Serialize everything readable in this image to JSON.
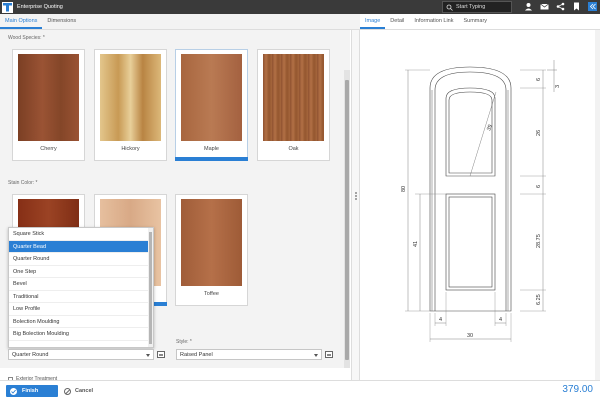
{
  "app": {
    "title": "Enterprise Quoting",
    "search_placeholder": "Start Typing",
    "icons": [
      "user-icon",
      "mail-icon",
      "share-icon",
      "bookmark-icon",
      "collapse-icon"
    ],
    "accent": "#2a7fd4"
  },
  "left_tabs": [
    "Main Options",
    "Dimensions"
  ],
  "wood_species": {
    "label": "Wood Species: *",
    "options": [
      {
        "name": "Cherry",
        "color": "#8a4a2c",
        "selected": false
      },
      {
        "name": "Hickory",
        "color": "#d9b877",
        "selected": false
      },
      {
        "name": "Maple",
        "color": "#b0704c",
        "selected": true
      },
      {
        "name": "Oak",
        "color": "#9c5d36",
        "selected": false
      }
    ]
  },
  "stain_color": {
    "label": "Stain Color: *",
    "options": [
      {
        "name": "",
        "color": "#8c3a1e"
      },
      {
        "name": "",
        "color": "#e2b896"
      },
      {
        "name": "Toffee",
        "color": "#a9643f"
      }
    ]
  },
  "profile_dropdown": {
    "items": [
      "Square Stick",
      "Quarter Bead",
      "Quarter Round",
      "One Step",
      "Bevel",
      "Traditional",
      "Low Profile",
      "Bolection Moulding",
      "Big Bolection Moulding"
    ],
    "highlighted": "Quarter Bead",
    "selected_value": "Quarter Round"
  },
  "style_field": {
    "label": "Style: *",
    "value": "Raised Panel"
  },
  "exterior_treatment": {
    "label": "Exterior Treatment"
  },
  "bottom": {
    "finish_label": "Finish",
    "cancel_label": "Cancel",
    "price": "379.00"
  },
  "right_tabs": [
    "Image",
    "Detail",
    "Information Link",
    "Summary"
  ],
  "drawing": {
    "dims": {
      "top_offset": "6",
      "top_small": "3",
      "upper_radius": "39",
      "upper_panel": "26",
      "rail": "6",
      "overall_height": "80",
      "lower_height": "41",
      "lower_panel": "28.75",
      "bottom_rail": "6.25",
      "stile_left": "4",
      "stile_right": "4",
      "overall_width": "30"
    }
  }
}
